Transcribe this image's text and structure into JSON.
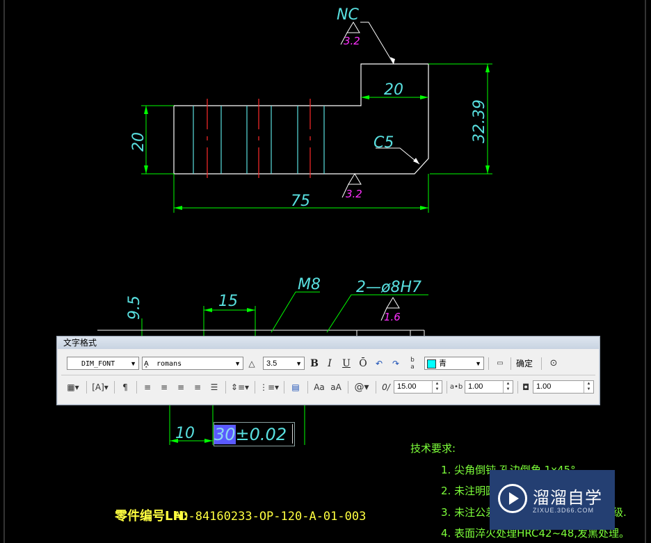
{
  "drawing": {
    "surface_mark_top": "NC",
    "roughness_top": "3.2",
    "dim_step_width": "20",
    "dim_height_right": "32.39",
    "dim_height_left": "20",
    "chamfer": "C5",
    "roughness_bottom": "3.2",
    "dim_total_length": "75",
    "dim_9_5": "9.5",
    "dim_15": "15",
    "thread_label": "M8",
    "hole_label": "2—ø8H7",
    "roughness_hole": "1.6",
    "dim_10": "10",
    "notes_title": "技术要求:",
    "notes": [
      "1. 尖角倒钝,孔边倒角 1x45°.",
      "2. 未注明圆",
      "3. 未注公差",
      "4. 表面淬火处理HRC42~48,发黑处理。"
    ],
    "notes_tail_3": "等级.",
    "part_label": "零件编号LH:",
    "part_number": "AD-84160233-OP-120-A-01-003",
    "colors": {
      "dimension": "#00ff00",
      "text_cyan": "#59e0e0",
      "centerline": "#ff2a2a",
      "roughness": "#ff30ff",
      "outline": "#ffffff",
      "notes": "#7dff3a",
      "part_number": "#ffff40"
    }
  },
  "editor": {
    "selected_text": "30",
    "rest_text": "±0.02"
  },
  "toolbar": {
    "title": "文字格式",
    "style": "DIM_FONT",
    "font": "romans",
    "height": "3.5",
    "bold": "B",
    "italic": "I",
    "underline": "U",
    "overline": "Ō",
    "color_name": "青",
    "color_swatch": "#00ffff",
    "ok_label": "确定",
    "case_upper": "Aa",
    "case_lower": "aA",
    "symbol": "@",
    "oblique_angle": "15.00",
    "tracking": "1.00",
    "width_factor": "1.00",
    "icons": {
      "undo": "undo-icon",
      "redo": "redo-icon",
      "stack": "stack-icon",
      "ruler": "ruler-icon",
      "options": "options-icon"
    }
  },
  "watermark": {
    "brand": "溜溜自学",
    "url": "ZIXUE.3D66.COM"
  }
}
